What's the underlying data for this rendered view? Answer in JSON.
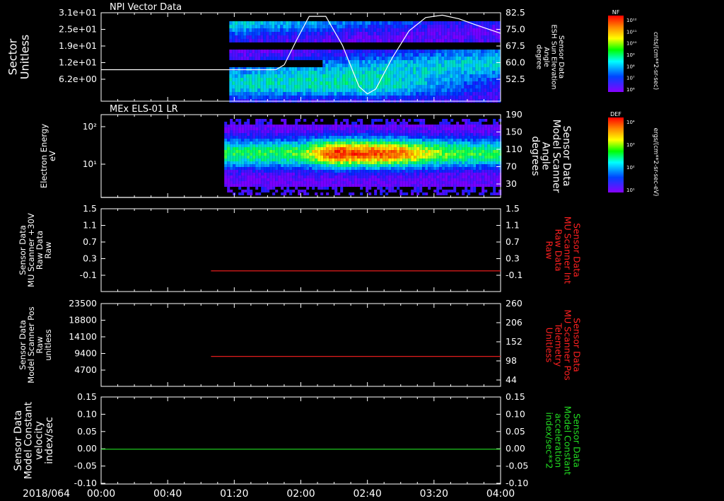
{
  "colors": {
    "white": "#ffffff",
    "red": "#ff2020",
    "green": "#22dd22",
    "background": "#000000"
  },
  "date_label": "2018/064",
  "x_axis": {
    "range_minutes": [
      0,
      240
    ],
    "ticks": [
      {
        "value": 0,
        "label": "00:00"
      },
      {
        "value": 40,
        "label": "00:40"
      },
      {
        "value": 80,
        "label": "01:20"
      },
      {
        "value": 120,
        "label": "02:00"
      },
      {
        "value": 160,
        "label": "02:40"
      },
      {
        "value": 200,
        "label": "03:20"
      },
      {
        "value": 240,
        "label": "04:00"
      }
    ]
  },
  "colorbars": [
    {
      "name": "NF",
      "unit": "cnts/(cm**2-sr-sec)",
      "ticks": [
        "10¹²",
        "10¹¹",
        "10¹⁰",
        "10⁹",
        "10⁸",
        "10⁷",
        "10⁶"
      ]
    },
    {
      "name": "DEF",
      "unit": "ergs/(cm**2-sr-sec-eV)",
      "ticks": [
        "10⁴",
        "10³",
        "10²",
        "10¹"
      ]
    }
  ],
  "chart_data": [
    {
      "type": "heatmap",
      "title": "NPI Vector Data",
      "ylabel": "Sector\nUnitless",
      "y_ticks": [
        "3.1e+01",
        "2.5e+01",
        "1.9e+01",
        "1.2e+01",
        "6.2e+00"
      ],
      "right_ylabel": "Sensor Data\nESH Sun Elevation\nAngle\ndegree",
      "right_y_ticks": [
        "82.5",
        "75.0",
        "67.5",
        "60.0",
        "52.5"
      ],
      "right_ylim": [
        46,
        82.5
      ],
      "data_start_minutes": 77,
      "overlay_line": {
        "x": [
          0,
          105,
          110,
          118,
          125,
          135,
          145,
          155,
          160,
          165,
          175,
          185,
          195,
          205,
          215,
          225,
          240
        ],
        "y": [
          59,
          59,
          61,
          72,
          81,
          81,
          69,
          52,
          49,
          51,
          64,
          75,
          80.5,
          81.5,
          80,
          77.5,
          74
        ]
      }
    },
    {
      "type": "heatmap",
      "title": "MEx ELS-01 LR",
      "ylabel": "Electron Energy\neV",
      "y_ticks": [
        "10²",
        "10¹"
      ],
      "right_ylabel": "Sensor Data\nModel Scanner\nAngle\ndegrees",
      "right_y_ticks": [
        "190",
        "150",
        "110",
        "70",
        "30"
      ],
      "right_ylim": [
        10,
        190
      ],
      "data_start_minutes": 74,
      "overlay_line": {
        "x": [
          0,
          240
        ],
        "y": [
          10,
          10
        ]
      }
    },
    {
      "type": "line",
      "ylabel": "Sensor Data\nMU Scanner +30V\nRaw Data\nRaw",
      "y_ticks": [
        "1.5",
        "1.1",
        "0.7",
        "0.3",
        "-0.1"
      ],
      "ylim": [
        -0.5,
        1.5
      ],
      "right_ylabel": "Sensor Data\nMU Scanner Int\nRaw Data\nRaw",
      "right_y_ticks": [
        "1.5",
        "1.1",
        "0.7",
        "0.3",
        "-0.1"
      ],
      "series": [
        {
          "x": [
            66,
            240
          ],
          "values": [
            0,
            0
          ]
        }
      ]
    },
    {
      "type": "line",
      "ylabel": "Sensor Data\nModel Scanner Pos\nRaw\nunitless",
      "y_ticks": [
        "23500",
        "18800",
        "14100",
        "9400",
        "4700"
      ],
      "ylim": [
        0,
        23500
      ],
      "right_ylabel": "Sensor Data\nMU Scanner Pos\nTelemetry\nUnitless",
      "right_y_ticks": [
        "260",
        "206",
        "152",
        "98",
        "44"
      ],
      "series": [
        {
          "x": [
            66,
            240
          ],
          "values": [
            8500,
            8500
          ]
        }
      ]
    },
    {
      "type": "line",
      "ylabel": "Sensor Data\nModel Constant\nvelocity\nindex/sec",
      "y_ticks": [
        "0.15",
        "0.10",
        "0.05",
        "0.00",
        "-0.05",
        "-0.10"
      ],
      "ylim": [
        -0.1,
        0.15
      ],
      "right_ylabel": "Sensor Data\nModel Constant\nacceleration\nindex/sec**2",
      "right_y_ticks": [
        "0.15",
        "0.10",
        "0.05",
        "0.00",
        "-0.05",
        "-0.10"
      ],
      "series": [
        {
          "x": [
            0,
            240
          ],
          "values": [
            0,
            0
          ]
        }
      ]
    }
  ]
}
